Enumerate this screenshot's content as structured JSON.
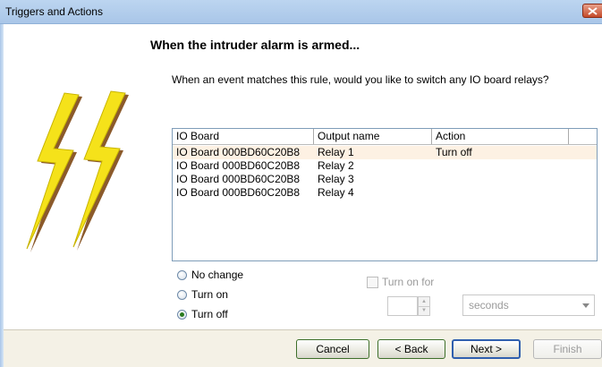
{
  "window": {
    "title": "Triggers and Actions"
  },
  "heading": "When the intruder alarm is armed...",
  "question": "When an event matches this rule, would you like to switch any IO board relays?",
  "grid": {
    "columns": [
      "IO Board",
      "Output name",
      "Action"
    ],
    "rows": [
      {
        "board": "IO Board 000BD60C20B8",
        "output": "Relay 1",
        "action": "Turn off",
        "selected": true
      },
      {
        "board": "IO Board 000BD60C20B8",
        "output": "Relay 2",
        "action": ""
      },
      {
        "board": "IO Board 000BD60C20B8",
        "output": "Relay 3",
        "action": ""
      },
      {
        "board": "IO Board 000BD60C20B8",
        "output": "Relay 4",
        "action": ""
      }
    ]
  },
  "options": {
    "no_change": "No change",
    "turn_on": "Turn on",
    "turn_off": "Turn off",
    "selected": "turn_off"
  },
  "turn_on_for": {
    "label": "Turn on for",
    "checked": false,
    "value": "",
    "unit": "seconds"
  },
  "buttons": {
    "cancel": "Cancel",
    "back": "< Back",
    "next": "Next >",
    "finish": "Finish"
  },
  "icons": {
    "close": "close-icon",
    "logo": "lightning-bolt-icon"
  },
  "colors": {
    "bolt_yellow": "#f5e21a",
    "bolt_shadow": "#8b5a2b",
    "titlebar": "#bcd5f0",
    "selected_row": "#fdf1e3"
  }
}
